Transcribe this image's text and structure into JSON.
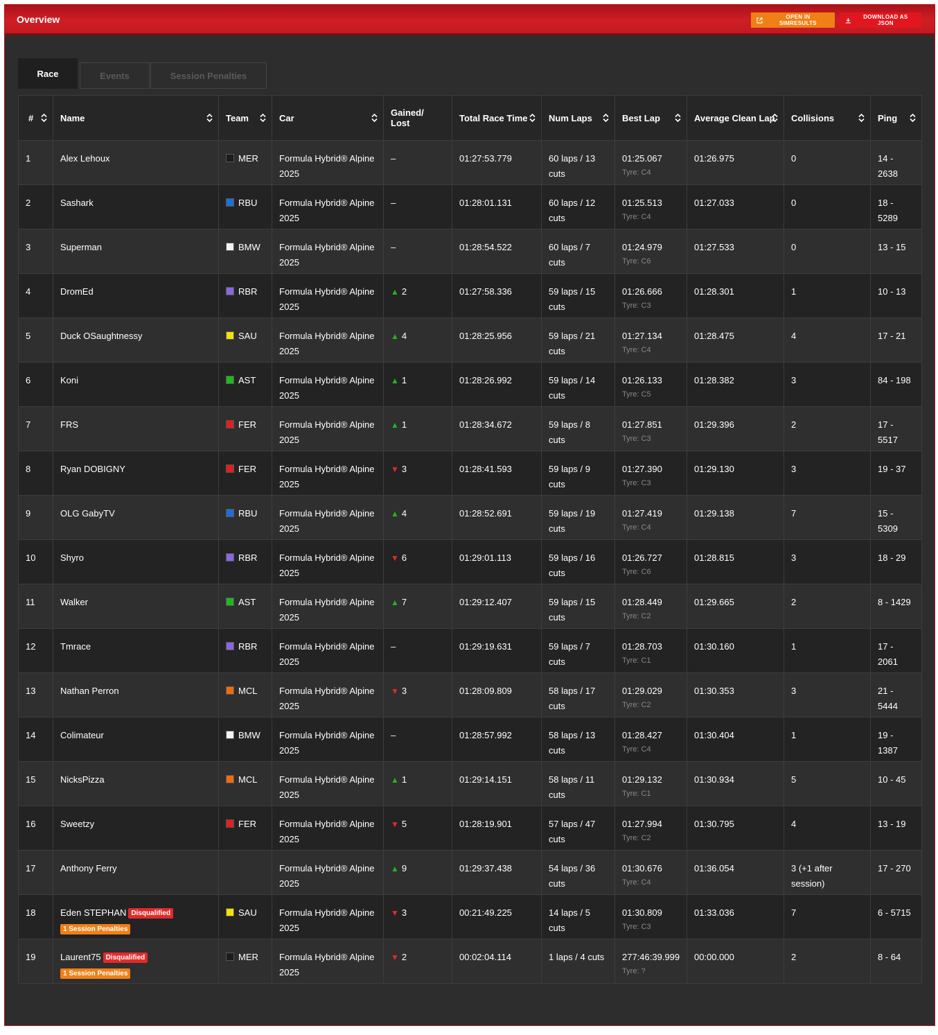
{
  "header": {
    "title": "Overview",
    "open_label": "OPEN IN SIMRESULTS",
    "download_label": "DOWNLOAD AS JSON"
  },
  "tabs": [
    {
      "label": "Race"
    },
    {
      "label": "Events"
    },
    {
      "label": "Session Penalties"
    }
  ],
  "columns": [
    "#",
    "Name",
    "Team",
    "Car",
    "Gained/ Lost",
    "Total Race Time",
    "Num Laps",
    "Best Lap",
    "Average Clean Lap",
    "Collisions",
    "Ping"
  ],
  "colors": {
    "accent_red": "#d01e24",
    "orange": "#f07f16",
    "gain_green": "#22b51f",
    "loss_red": "#e02b2b"
  },
  "team_colors": {
    "MER": "#1c1c1c",
    "RBU": "#1e6fd9",
    "BMW": "#f4f4f4",
    "RBR": "#8a67e0",
    "SAU": "#f2e300",
    "AST": "#1fb81f",
    "FER": "#e01f1f",
    "MCL": "#f06b10"
  },
  "rows": [
    {
      "pos": "1",
      "name": "Alex Lehoux",
      "team": "MER",
      "car": "Formula Hybrid® Alpine 2025",
      "gain_dir": "none",
      "gain": "–",
      "time": "01:27:53.779",
      "laps": "60 laps / 13 cuts",
      "best": "01:25.067",
      "tyre": "Tyre: C4",
      "avg": "01:26.975",
      "coll": "0",
      "ping": "14 - 2638"
    },
    {
      "pos": "2",
      "name": "Sashark",
      "team": "RBU",
      "car": "Formula Hybrid® Alpine 2025",
      "gain_dir": "none",
      "gain": "–",
      "time": "01:28:01.131",
      "laps": "60 laps / 12 cuts",
      "best": "01:25.513",
      "tyre": "Tyre: C4",
      "avg": "01:27.033",
      "coll": "0",
      "ping": "18 - 5289"
    },
    {
      "pos": "3",
      "name": "Superman",
      "team": "BMW",
      "car": "Formula Hybrid® Alpine 2025",
      "gain_dir": "none",
      "gain": "–",
      "time": "01:28:54.522",
      "laps": "60 laps / 7 cuts",
      "best": "01:24.979",
      "tyre": "Tyre: C6",
      "avg": "01:27.533",
      "coll": "0",
      "ping": "13 - 15"
    },
    {
      "pos": "4",
      "name": "DromEd",
      "team": "RBR",
      "car": "Formula Hybrid® Alpine 2025",
      "gain_dir": "up",
      "gain": "2",
      "time": "01:27:58.336",
      "laps": "59 laps / 15 cuts",
      "best": "01:26.666",
      "tyre": "Tyre: C3",
      "avg": "01:28.301",
      "coll": "1",
      "ping": "10 - 13"
    },
    {
      "pos": "5",
      "name": "Duck OSaughtnessy",
      "team": "SAU",
      "car": "Formula Hybrid® Alpine 2025",
      "gain_dir": "up",
      "gain": "4",
      "time": "01:28:25.956",
      "laps": "59 laps / 21 cuts",
      "best": "01:27.134",
      "tyre": "Tyre: C4",
      "avg": "01:28.475",
      "coll": "4",
      "ping": "17 - 21"
    },
    {
      "pos": "6",
      "name": "Koni",
      "team": "AST",
      "car": "Formula Hybrid® Alpine 2025",
      "gain_dir": "up",
      "gain": "1",
      "time": "01:28:26.992",
      "laps": "59 laps / 14 cuts",
      "best": "01:26.133",
      "tyre": "Tyre: C5",
      "avg": "01:28.382",
      "coll": "3",
      "ping": "84 - 198"
    },
    {
      "pos": "7",
      "name": "FRS",
      "team": "FER",
      "car": "Formula Hybrid® Alpine 2025",
      "gain_dir": "up",
      "gain": "1",
      "time": "01:28:34.672",
      "laps": "59 laps / 8 cuts",
      "best": "01:27.851",
      "tyre": "Tyre: C3",
      "avg": "01:29.396",
      "coll": "2",
      "ping": "17 - 5517"
    },
    {
      "pos": "8",
      "name": "Ryan DOBIGNY",
      "team": "FER",
      "car": "Formula Hybrid® Alpine 2025",
      "gain_dir": "down",
      "gain": "3",
      "time": "01:28:41.593",
      "laps": "59 laps / 9 cuts",
      "best": "01:27.390",
      "tyre": "Tyre: C3",
      "avg": "01:29.130",
      "coll": "3",
      "ping": "19 - 37"
    },
    {
      "pos": "9",
      "name": "OLG GabyTV",
      "team": "RBU",
      "car": "Formula Hybrid® Alpine 2025",
      "gain_dir": "up",
      "gain": "4",
      "time": "01:28:52.691",
      "laps": "59 laps / 19 cuts",
      "best": "01:27.419",
      "tyre": "Tyre: C4",
      "avg": "01:29.138",
      "coll": "7",
      "ping": "15 - 5309"
    },
    {
      "pos": "10",
      "name": "Shyro",
      "team": "RBR",
      "car": "Formula Hybrid® Alpine 2025",
      "gain_dir": "down",
      "gain": "6",
      "time": "01:29:01.113",
      "laps": "59 laps / 16 cuts",
      "best": "01:26.727",
      "tyre": "Tyre: C6",
      "avg": "01:28.815",
      "coll": "3",
      "ping": "18 - 29"
    },
    {
      "pos": "11",
      "name": "Walker",
      "team": "AST",
      "car": "Formula Hybrid® Alpine 2025",
      "gain_dir": "up",
      "gain": "7",
      "time": "01:29:12.407",
      "laps": "59 laps / 15 cuts",
      "best": "01:28.449",
      "tyre": "Tyre: C2",
      "avg": "01:29.665",
      "coll": "2",
      "ping": "8 - 1429"
    },
    {
      "pos": "12",
      "name": "Tmrace",
      "team": "RBR",
      "car": "Formula Hybrid® Alpine 2025",
      "gain_dir": "none",
      "gain": "–",
      "time": "01:29:19.631",
      "laps": "59 laps / 7 cuts",
      "best": "01:28.703",
      "tyre": "Tyre: C1",
      "avg": "01:30.160",
      "coll": "1",
      "ping": "17 - 2061"
    },
    {
      "pos": "13",
      "name": "Nathan Perron",
      "team": "MCL",
      "car": "Formula Hybrid® Alpine 2025",
      "gain_dir": "down",
      "gain": "3",
      "time": "01:28:09.809",
      "laps": "58 laps / 17 cuts",
      "best": "01:29.029",
      "tyre": "Tyre: C2",
      "avg": "01:30.353",
      "coll": "3",
      "ping": "21 - 5444"
    },
    {
      "pos": "14",
      "name": "Colimateur",
      "team": "BMW",
      "car": "Formula Hybrid® Alpine 2025",
      "gain_dir": "none",
      "gain": "–",
      "time": "01:28:57.992",
      "laps": "58 laps / 13 cuts",
      "best": "01:28.427",
      "tyre": "Tyre: C4",
      "avg": "01:30.404",
      "coll": "1",
      "ping": "19 - 1387"
    },
    {
      "pos": "15",
      "name": "NicksPizza",
      "team": "MCL",
      "car": "Formula Hybrid® Alpine 2025",
      "gain_dir": "up",
      "gain": "1",
      "time": "01:29:14.151",
      "laps": "58 laps / 11 cuts",
      "best": "01:29.132",
      "tyre": "Tyre: C1",
      "avg": "01:30.934",
      "coll": "5",
      "ping": "10 - 45"
    },
    {
      "pos": "16",
      "name": "Sweetzy",
      "team": "FER",
      "car": "Formula Hybrid® Alpine 2025",
      "gain_dir": "down",
      "gain": "5",
      "time": "01:28:19.901",
      "laps": "57 laps / 47 cuts",
      "best": "01:27.994",
      "tyre": "Tyre: C2",
      "avg": "01:30.795",
      "coll": "4",
      "ping": "13 - 19"
    },
    {
      "pos": "17",
      "name": "Anthony Ferry",
      "team": "",
      "car": "Formula Hybrid® Alpine 2025",
      "gain_dir": "up",
      "gain": "9",
      "time": "01:29:37.438",
      "laps": "54 laps / 36 cuts",
      "best": "01:30.676",
      "tyre": "Tyre: C4",
      "avg": "01:36.054",
      "coll": "3 (+1 after session)",
      "ping": "17 - 270"
    },
    {
      "pos": "18",
      "name": "Eden STEPHAN",
      "dq": "Disqualified",
      "penalty": "1 Session Penalties",
      "team": "SAU",
      "car": "Formula Hybrid® Alpine 2025",
      "gain_dir": "down",
      "gain": "3",
      "time": "00:21:49.225",
      "laps": "14 laps / 5 cuts",
      "best": "01:30.809",
      "tyre": "Tyre: C3",
      "avg": "01:33.036",
      "coll": "7",
      "ping": "6 - 5715"
    },
    {
      "pos": "19",
      "name": "Laurent75",
      "dq": "Disqualified",
      "penalty": "1 Session Penalties",
      "team": "MER",
      "car": "Formula Hybrid® Alpine 2025",
      "gain_dir": "down",
      "gain": "2",
      "time": "00:02:04.114",
      "laps": "1 laps / 4 cuts",
      "best": "277:46:39.999",
      "tyre": "Tyre: ?",
      "avg": "00:00.000",
      "coll": "2",
      "ping": "8 - 64"
    }
  ]
}
